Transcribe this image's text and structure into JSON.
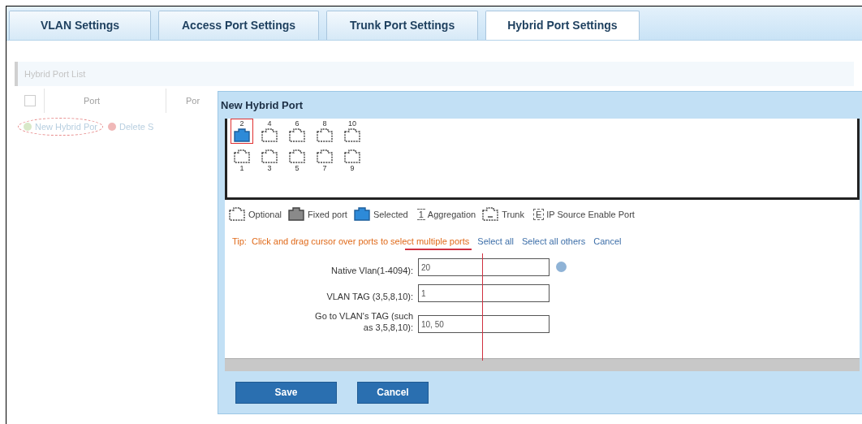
{
  "tabs": [
    {
      "label": "VLAN Settings",
      "selected": false
    },
    {
      "label": "Access Port Settings",
      "selected": false
    },
    {
      "label": "Trunk Port Settings",
      "selected": false
    },
    {
      "label": "Hybrid Port Settings",
      "selected": true
    }
  ],
  "background": {
    "list_title": "Hybrid Port List",
    "select_all_checked": false,
    "columns": [
      "Port",
      "Por"
    ],
    "actions": [
      {
        "label": "New Hybrid Por",
        "kind": "add",
        "circled": true
      },
      {
        "label": "Delete S",
        "kind": "delete",
        "circled": false
      }
    ]
  },
  "dialog": {
    "title": "New Hybrid Port",
    "port_rows": [
      [
        {
          "number": "2",
          "selected": true,
          "outlined": true
        },
        {
          "number": "4",
          "selected": false,
          "outlined": false
        },
        {
          "number": "6",
          "selected": false,
          "outlined": false
        },
        {
          "number": "8",
          "selected": false,
          "outlined": false
        },
        {
          "number": "10",
          "selected": false,
          "outlined": false
        }
      ],
      [
        {
          "number": "1",
          "selected": false,
          "outlined": false
        },
        {
          "number": "3",
          "selected": false,
          "outlined": false
        },
        {
          "number": "5",
          "selected": false,
          "outlined": false
        },
        {
          "number": "7",
          "selected": false,
          "outlined": false
        },
        {
          "number": "9",
          "selected": false,
          "outlined": false
        }
      ]
    ],
    "legend": [
      {
        "kind": "optional",
        "label": "Optional"
      },
      {
        "kind": "fixed",
        "label": "Fixed port"
      },
      {
        "kind": "selected",
        "label": "Selected"
      },
      {
        "kind": "aggregation",
        "glyph": "1",
        "label": "Aggregation"
      },
      {
        "kind": "trunk",
        "label": "Trunk"
      },
      {
        "kind": "ip_source",
        "glyph": "E",
        "label": "IP Source Enable Port"
      }
    ],
    "tip": {
      "label": "Tip:",
      "text": "Click and drag cursor over ports to select multiple ports",
      "links": [
        "Select all",
        "Select all others",
        "Cancel"
      ]
    },
    "fields": [
      {
        "label": "Native Vlan(1-4094):",
        "value": "20",
        "info": true
      },
      {
        "label": "VLAN TAG (3,5,8,10):",
        "value": "1"
      },
      {
        "label": "Go to VLAN's TAG (such as 3,5,8,10):",
        "value": "10, 50"
      }
    ],
    "buttons": [
      "Save",
      "Cancel"
    ]
  }
}
